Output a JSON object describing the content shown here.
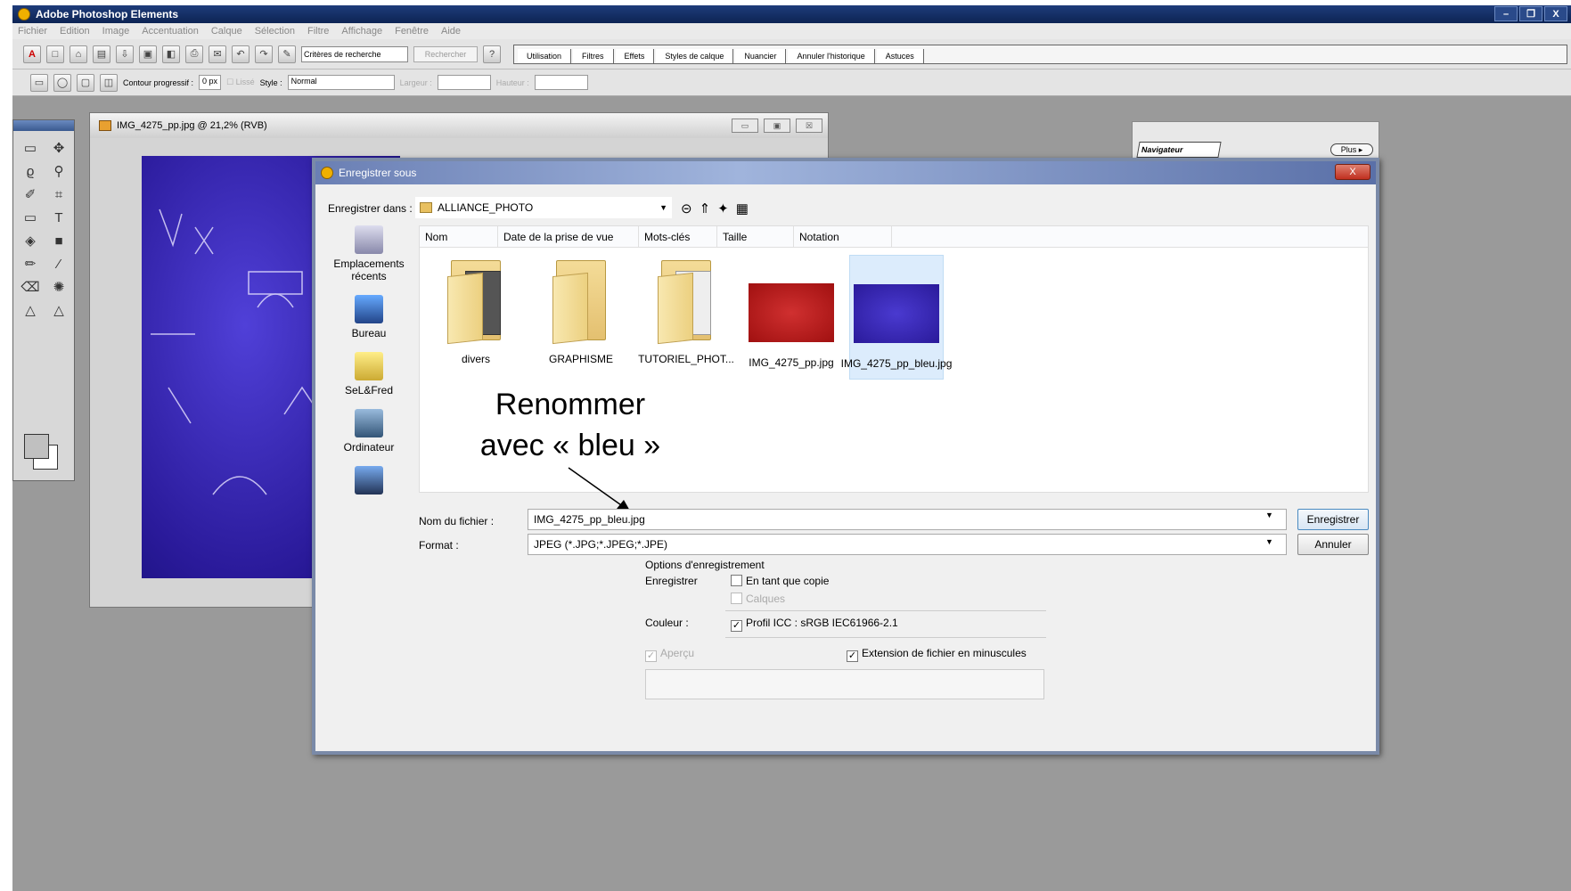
{
  "app": {
    "title": "Adobe Photoshop Elements"
  },
  "menu": [
    "Fichier",
    "Edition",
    "Image",
    "Accentuation",
    "Calque",
    "Sélection",
    "Filtre",
    "Affichage",
    "Fenêtre",
    "Aide"
  ],
  "toolbar": {
    "search_placeholder": "Critères de recherche",
    "search_button": "Rechercher",
    "tabs": [
      "Utilisation",
      "Filtres",
      "Effets",
      "Styles de calque",
      "Nuancier",
      "Annuler l'historique",
      "Astuces"
    ]
  },
  "options_bar": {
    "feather_label": "Contour progressif :",
    "feather_value": "0 px",
    "lisse": "Lissé",
    "style_label": "Style :",
    "style_value": "Normal",
    "width_label": "Largeur :",
    "height_label": "Hauteur :"
  },
  "document": {
    "title": "IMG_4275_pp.jpg @ 21,2% (RVB)"
  },
  "navigator": {
    "tab": "Navigateur",
    "more": "Plus ▸"
  },
  "dialog": {
    "title": "Enregistrer sous",
    "save_in_label": "Enregistrer dans :",
    "save_in_value": "ALLIANCE_PHOTO",
    "places": [
      "Emplacements récents",
      "Bureau",
      "SeL&Fred",
      "Ordinateur"
    ],
    "columns": [
      "Nom",
      "Date de la prise de vue",
      "Mots-clés",
      "Taille",
      "Notation"
    ],
    "items": [
      "divers",
      "GRAPHISME",
      "TUTORIEL_PHOT...",
      "IMG_4275_pp.jpg",
      "IMG_4275_pp_bleu.jpg"
    ],
    "filename_label": "Nom du fichier :",
    "filename_value": "IMG_4275_pp_bleu.jpg",
    "format_label": "Format :",
    "format_value": "JPEG (*.JPG;*.JPEG;*.JPE)",
    "save_button": "Enregistrer",
    "cancel_button": "Annuler",
    "options_title": "Options d'enregistrement",
    "save_label": "Enregistrer",
    "as_copy": "En tant que copie",
    "layers": "Calques",
    "color_label": "Couleur :",
    "icc_profile": "Profil ICC : sRGB IEC61966-2.1",
    "preview": "Aperçu",
    "lowercase_ext": "Extension de fichier en minuscules"
  },
  "callout": {
    "line1": "Renommer",
    "line2": "avec « bleu »"
  }
}
